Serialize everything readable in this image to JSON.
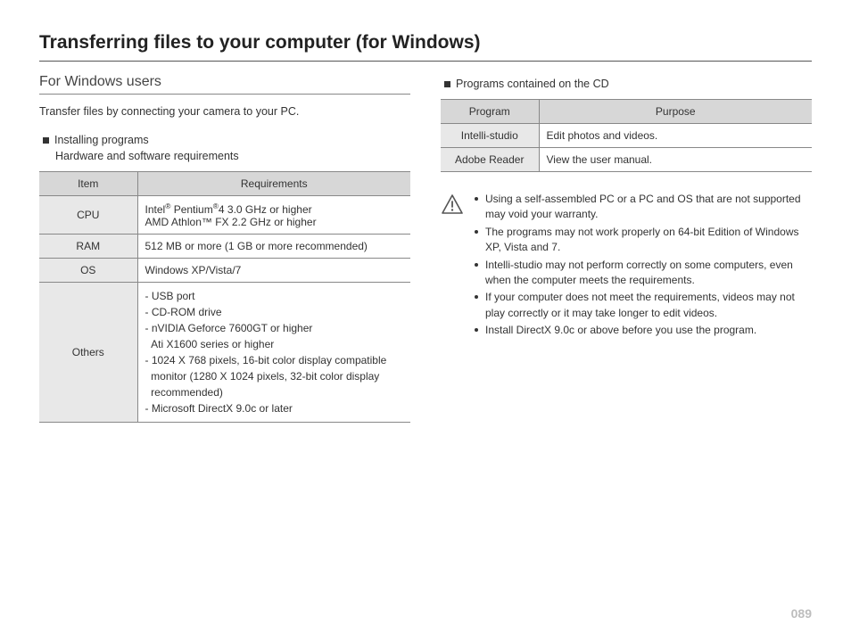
{
  "page": {
    "title": "Transferring files to your computer (for Windows)",
    "number": "089"
  },
  "left": {
    "section_heading": "For Windows users",
    "intro": "Transfer files by connecting your camera to your PC.",
    "subhead1": "Installing programs",
    "subhead1_sub": "Hardware and software requirements",
    "table_headers": {
      "item": "Item",
      "req": "Requirements"
    },
    "table": {
      "cpu_label": "CPU",
      "cpu_val_html": "Intel<sup>®</sup> Pentium<sup>®</sup>4 3.0 GHz or higher<br>AMD Athlon™ FX 2.2 GHz or higher",
      "ram_label": "RAM",
      "ram_val": "512 MB or more (1 GB or more recommended)",
      "os_label": "OS",
      "os_val": "Windows XP/Vista/7",
      "others_label": "Others",
      "others_items": [
        "- USB port",
        "- CD-ROM drive",
        "- nVIDIA Geforce 7600GT or higher",
        "  Ati X1600 series or higher",
        "- 1024 X 768 pixels, 16-bit color display compatible",
        "  monitor (1280 X 1024 pixels, 32-bit color display",
        "  recommended)",
        "- Microsoft DirectX 9.0c or later"
      ]
    }
  },
  "right": {
    "subhead2": "Programs contained on the CD",
    "prog_headers": {
      "program": "Program",
      "purpose": "Purpose"
    },
    "prog_rows": [
      {
        "program": "Intelli-studio",
        "purpose": "Edit photos and videos."
      },
      {
        "program": "Adobe Reader",
        "purpose": "View the user manual."
      }
    ],
    "warnings": [
      "Using a self-assembled PC or a PC and OS that are not supported may void your warranty.",
      "The programs may not work properly on 64-bit Edition of Windows XP, Vista and 7.",
      "Intelli-studio may not perform correctly on some computers, even when the computer meets the requirements.",
      "If your computer does not meet the requirements, videos may not play correctly or it may take longer to edit videos.",
      "Install DirectX 9.0c or above before you use the program."
    ]
  }
}
